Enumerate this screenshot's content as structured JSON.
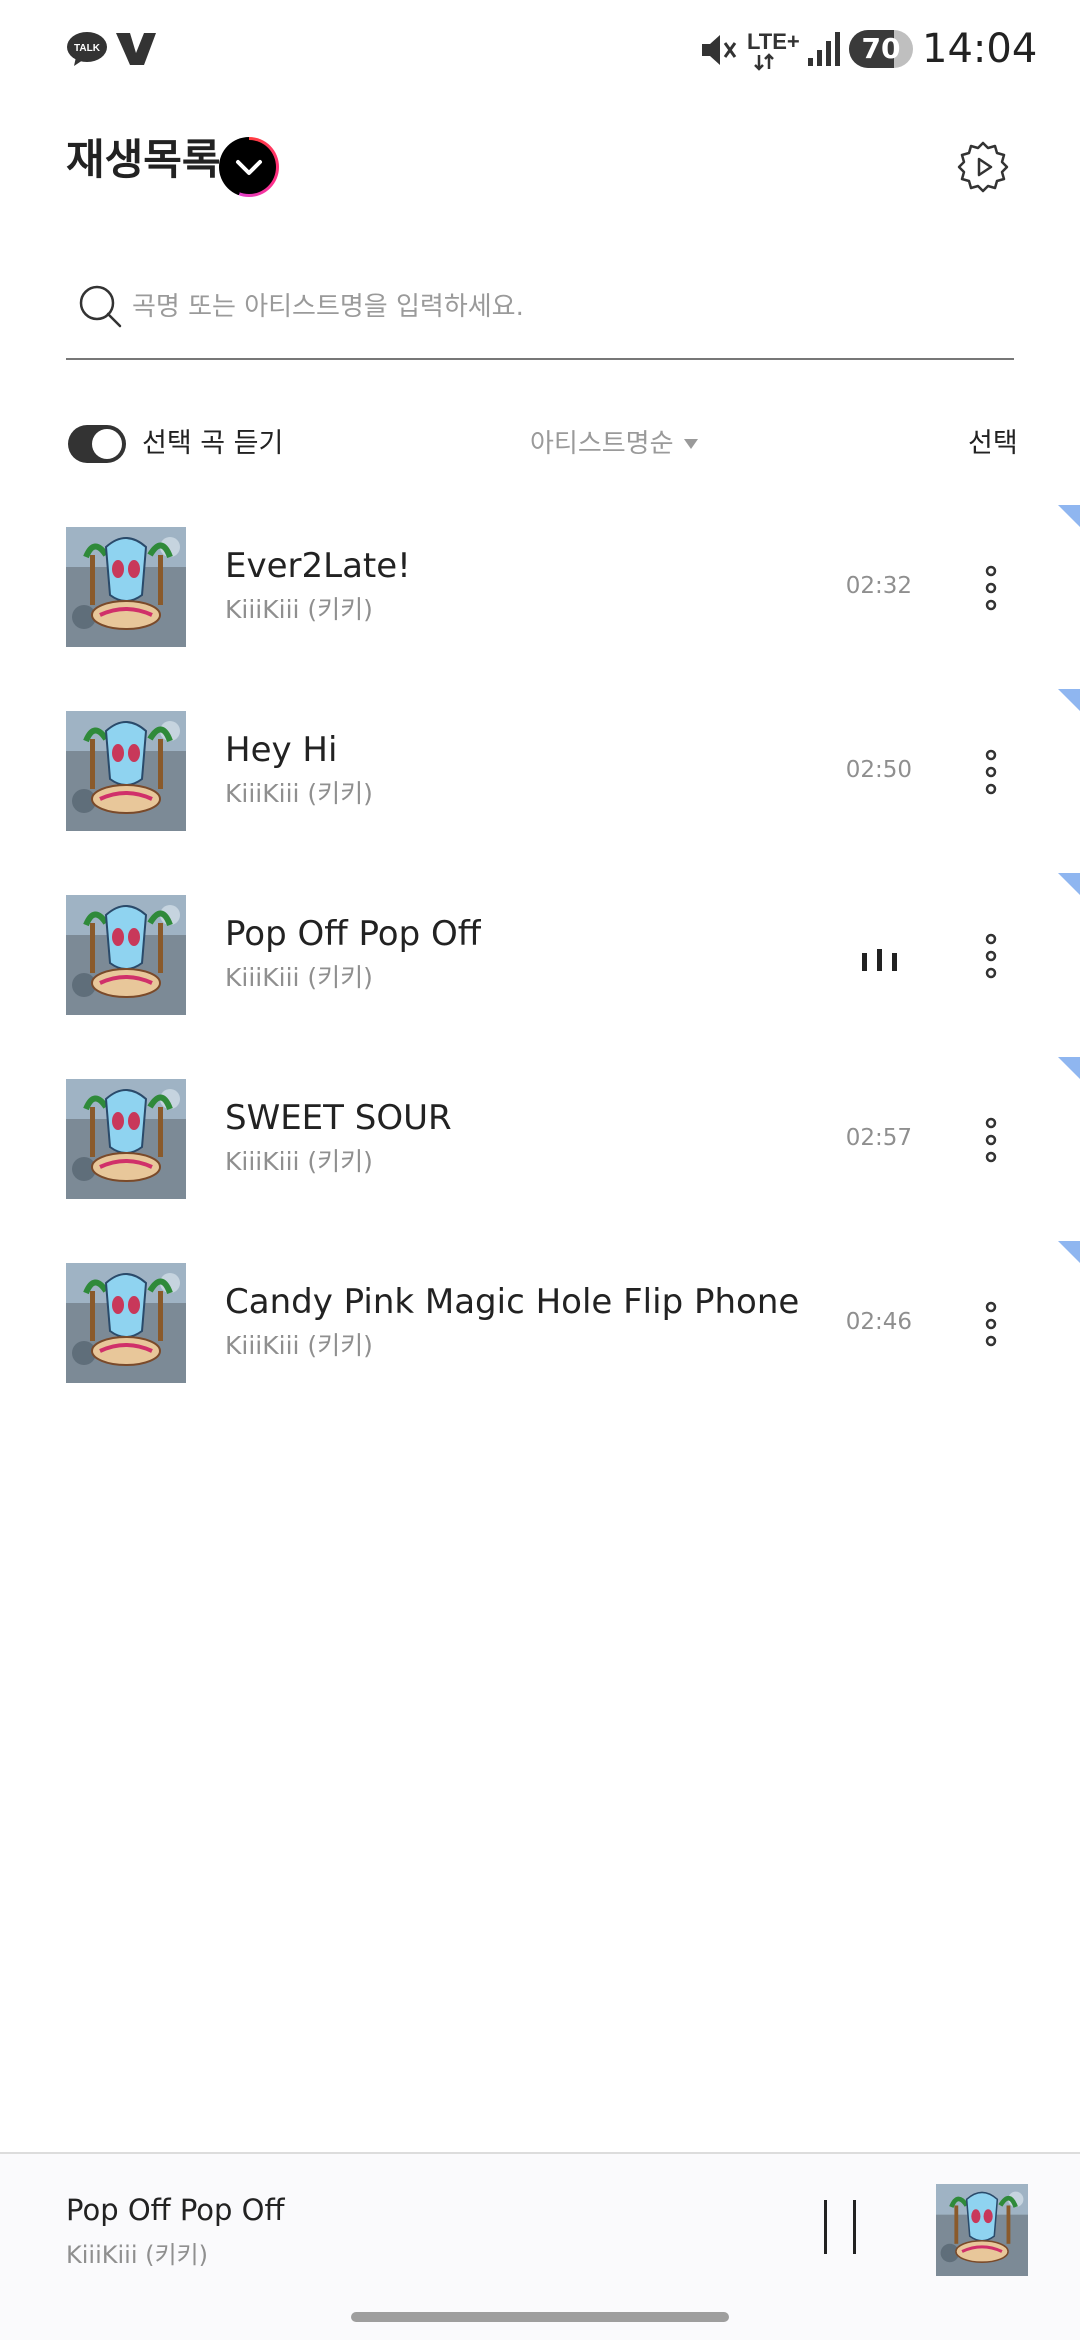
{
  "status_bar": {
    "time": "14:04",
    "battery_level": "70",
    "network": "LTE+",
    "icons": [
      "kakaotalk-icon",
      "v-app-icon",
      "mute-icon",
      "lte-icon",
      "signal-icon",
      "battery-icon"
    ]
  },
  "header": {
    "title": "재생목록",
    "dropdown_icon": "chevron-down-icon",
    "settings_icon": "settings-play-icon"
  },
  "search": {
    "placeholder": "곡명 또는 아티스트명을 입력하세요.",
    "value": ""
  },
  "toolbar": {
    "toggle_label": "선택 곡 듣기",
    "toggle_on": true,
    "sort_label": "아티스트명순",
    "select_label": "선택"
  },
  "tracks": [
    {
      "title": "Ever2Late!",
      "artist": "KiiiKiii (키키)",
      "duration": "02:32",
      "playing": false
    },
    {
      "title": "Hey Hi",
      "artist": "KiiiKiii (키키)",
      "duration": "02:50",
      "playing": false
    },
    {
      "title": "Pop Off Pop Off",
      "artist": "KiiiKiii (키키)",
      "duration": "",
      "playing": true
    },
    {
      "title": "SWEET SOUR",
      "artist": "KiiiKiii (키키)",
      "duration": "02:57",
      "playing": false
    },
    {
      "title": "Candy Pink Magic Hole Flip Phone (…",
      "artist": "KiiiKiii (키키)",
      "duration": "02:46",
      "playing": false
    }
  ],
  "now_playing": {
    "title": "Pop Off Pop Off",
    "artist": "KiiiKiii (키키)"
  },
  "colors": {
    "accent_gradient": [
      "#ff3d3d",
      "#ff2f8a",
      "#e040c8"
    ],
    "corner_mark": "#8fb6f0",
    "text_primary": "#222222",
    "text_secondary": "#8f8f8f"
  }
}
